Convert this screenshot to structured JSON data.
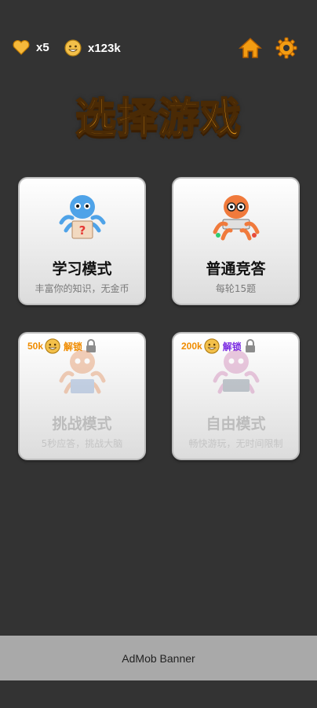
{
  "stats": {
    "lives": "x5",
    "coins": "x123k"
  },
  "icons": {
    "lives": "heart-icon",
    "coins": "coin-icon",
    "home": "home-icon",
    "settings": "gear-icon",
    "lock": "lock-icon"
  },
  "title": "选择游戏",
  "modes": [
    {
      "name": "学习模式",
      "desc": "丰富你的知识，无金币",
      "locked": false
    },
    {
      "name": "普通竞答",
      "desc": "每轮15题",
      "locked": false
    },
    {
      "name": "挑战模式",
      "desc": "5秒应答，挑战大脑",
      "locked": true,
      "cost": "50k",
      "unlock_label": "解锁",
      "unlock_color": "#f08c00"
    },
    {
      "name": "自由模式",
      "desc": "畅快游玩，无时间限制",
      "locked": true,
      "cost": "200k",
      "unlock_label": "解锁",
      "unlock_color": "#7a2be2"
    }
  ],
  "banner": "AdMob Banner",
  "colors": {
    "accent": "#f6a21a",
    "background": "#333333",
    "banner": "#a9a9a9"
  }
}
